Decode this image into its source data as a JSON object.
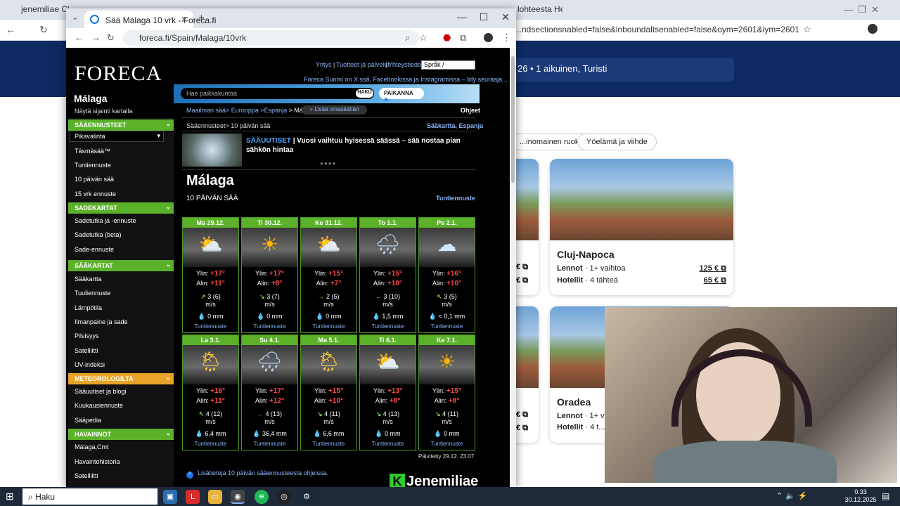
{
  "background_browser": {
    "tabs": [
      "jenemiliae Cl...",
      "lohteesta Helsinki"
    ],
    "url": "...ndsectionsnabled=false&inboundaltsenabled=false&oym=2601&iym=2601",
    "search_summary": "26 • 1 aikuinen, Turisti",
    "chips": [
      "...inomainen ruoka",
      "Yöelämä ja viihde"
    ],
    "cards": [
      {
        "title": "Cluj-Napoca",
        "flights_label": "Lennot",
        "flights_info": "· 1+ vaihtoa",
        "flight_price": "125 €",
        "hotels_label": "Hotellit",
        "hotels_info": "· 4 tähteä",
        "hotel_price": "65 €"
      },
      {
        "title": "Oradea",
        "flights_label": "Lennot",
        "flights_info": "· 1+ va...",
        "hotels_label": "Hotellit",
        "hotels_info": "· 4 t..."
      }
    ]
  },
  "window": {
    "tab_title": "Sää Málaga 10 vrk - Foreca.fi",
    "url": "foreca.fi/Spain/Malaga/10vrk"
  },
  "foreca": {
    "logo": "FORECA",
    "top_links": [
      "Yritys",
      "Tuotteet ja palvelut",
      "Yhteystiedot"
    ],
    "language": "Språk / Language",
    "promo": "Foreca Suomi on X:ssä, Facebookissa ja Instagramissa – liity seuraaja...",
    "place": "Málaga",
    "place_map_link": "Näytä sijainti kartalla",
    "search_placeholder": "Hae paikkakuntaa",
    "search_button": "HAKU",
    "locate_button": "PAIKANNA",
    "breadcrumb": [
      "Maailman sää",
      "Eurooppa",
      "Espanja",
      "Málaga"
    ],
    "add_favourite": "+ Lisää omasäähän",
    "help": "Ohjeet",
    "sub_breadcrumb": "Sääennusteet> 10 päivän sää",
    "region_map": "Sääkartta, Espanja",
    "news_tag": "SÄÄUUTISET",
    "news_text": "| Vuosi vaihtuu hyisessä säässä – sää nostaa pian sähkön hintaa",
    "city_heading": "Málaga",
    "section_heading": "10 PÄIVÄN SÄÄ",
    "hourly_link": "Tuntiennuste",
    "updated": "Päivitetty 29.12. 23.07",
    "info_line": "Lisätietoja 10 päivän sääennusteesta ohjeissa.",
    "brand": "Jenemiliae"
  },
  "sidebar": {
    "sections": [
      {
        "title": "SÄÄENNUSTEET",
        "items": [
          "Täsmäsää™",
          "Tuntiennuste",
          "10 päivän sää",
          "15 vrk ennuste"
        ]
      },
      {
        "title": "SADEKARTAT",
        "items": [
          "Sadetutka ja -ennuste",
          "Sadetutka (beta)",
          "Sade-ennuste"
        ]
      },
      {
        "title": "SÄÄKARTAT",
        "items": [
          "Sääkartta",
          "Tuuliennuste",
          "Lämpötila",
          "Ilmanpaine ja sade",
          "Pilvisyys",
          "Satelliitti",
          "UV-indeksi"
        ]
      },
      {
        "title": "METEOROLOGILTA",
        "items": [
          "Sääuutiset ja blogi",
          "Kuukausiennuste",
          "Sääpedia"
        ]
      },
      {
        "title": "HAVAINNOT",
        "items": [
          "Málaga,Cmt",
          "Havaintohistoria",
          "Satelliitti"
        ]
      }
    ],
    "quick_select": "Pikavalinta"
  },
  "days_labels": {
    "max": "Ylin:",
    "min": "Alin:",
    "unit": "m/s",
    "link": "Tuntiennuste"
  },
  "days": [
    {
      "name": "Ma 29.12.",
      "icon": "partly-cloudy-icon",
      "max": "+17°",
      "min": "+11°",
      "arrow": "↗",
      "wind": "3 (6)",
      "rain": "0 mm"
    },
    {
      "name": "Ti 30.12.",
      "icon": "sun-icon",
      "max": "+17°",
      "min": "+8°",
      "arrow": "↘",
      "wind": "3 (7)",
      "rain": "0 mm"
    },
    {
      "name": "Ke 31.12.",
      "icon": "partly-cloudy-icon",
      "max": "+15°",
      "min": "+7°",
      "arrow": "→",
      "wind": "2 (5)",
      "rain": "0 mm"
    },
    {
      "name": "To 1.1.",
      "icon": "rain-cloud-icon",
      "max": "+15°",
      "min": "+10°",
      "arrow": "←",
      "wind": "3 (10)",
      "rain": "1,5 mm"
    },
    {
      "name": "Pe 2.1.",
      "icon": "cloud-icon",
      "max": "+16°",
      "min": "+10°",
      "arrow": "↖",
      "wind": "3 (5)",
      "rain": "< 0,1 mm"
    },
    {
      "name": "La 3.1.",
      "icon": "sun-rain-icon",
      "max": "+16°",
      "min": "+11°",
      "arrow": "↖",
      "wind": "4 (12)",
      "rain": "6,4 mm"
    },
    {
      "name": "Su 4.1.",
      "icon": "rain-cloud-icon",
      "max": "+17°",
      "min": "+12°",
      "arrow": "←",
      "wind": "4 (13)",
      "rain": "36,4 mm"
    },
    {
      "name": "Ma 5.1.",
      "icon": "sun-rain-icon",
      "max": "+15°",
      "min": "+10°",
      "arrow": "↘",
      "wind": "4 (11)",
      "rain": "6,6 mm"
    },
    {
      "name": "Ti 6.1.",
      "icon": "partly-cloudy-icon",
      "max": "+13°",
      "min": "+8°",
      "arrow": "↘",
      "wind": "4 (13)",
      "rain": "0 mm"
    },
    {
      "name": "Ke 7.1.",
      "icon": "sun-icon",
      "max": "+15°",
      "min": "+8°",
      "arrow": "↘",
      "wind": "4 (11)",
      "rain": "0 mm"
    }
  ],
  "taskbar": {
    "search": "Haku",
    "time": "0.33",
    "date": "30.12.2025"
  }
}
